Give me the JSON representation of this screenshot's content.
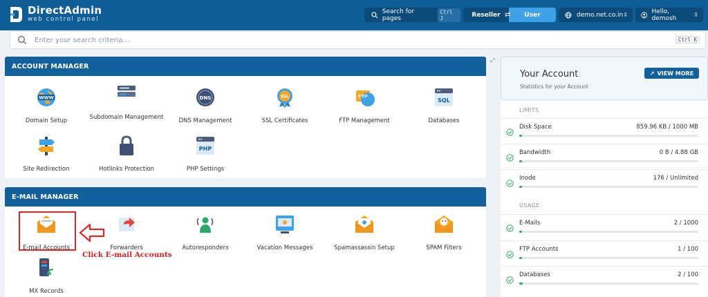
{
  "header": {
    "brand": "DirectAdmin",
    "brand_sub": "web control panel",
    "search_pages_label": "Search for pages",
    "search_pages_shortcut": "Ctrl J",
    "role_reseller": "Reseller",
    "role_user": "User",
    "domain": "demo.net.co.in",
    "greeting": "Hello, demosh"
  },
  "search": {
    "placeholder": "Enter your search criteria...",
    "shortcut": "Ctrl K"
  },
  "account_manager": {
    "title": "ACCOUNT MANAGER",
    "items": [
      {
        "label": "Domain Setup",
        "icon": "globe-www-icon"
      },
      {
        "label": "Subdomain Management",
        "icon": "subdomain-icon"
      },
      {
        "label": "DNS Management",
        "icon": "dns-icon"
      },
      {
        "label": "SSL Certificates",
        "icon": "ssl-badge-icon"
      },
      {
        "label": "FTP Management",
        "icon": "ftp-icon"
      },
      {
        "label": "Databases",
        "icon": "sql-database-icon"
      },
      {
        "label": "Site Redirection",
        "icon": "signpost-icon"
      },
      {
        "label": "Hotlinks Protection",
        "icon": "padlock-icon"
      },
      {
        "label": "PHP Settings",
        "icon": "php-icon"
      }
    ]
  },
  "email_manager": {
    "title": "E-MAIL MANAGER",
    "items": [
      {
        "label": "E-mail Accounts",
        "icon": "envelope-icon"
      },
      {
        "label": "Forwarders",
        "icon": "forward-mail-icon"
      },
      {
        "label": "Autoresponders",
        "icon": "autoresponder-icon"
      },
      {
        "label": "Vacation Messages",
        "icon": "vacation-message-icon"
      },
      {
        "label": "Spamassassin Setup",
        "icon": "spam-envelope-icon"
      },
      {
        "label": "SPAM Filters",
        "icon": "spam-filter-icon"
      },
      {
        "label": "MX Records",
        "icon": "mx-records-icon"
      }
    ]
  },
  "your_account": {
    "title": "Your Account",
    "subtitle": "Statistics for your Account",
    "view_more": "VIEW MORE",
    "limits_label": "LIMITS",
    "usage_label": "USAGE",
    "limits": [
      {
        "name": "Disk Space",
        "value": "859.96 KB / 1000 MB",
        "fraction": 0.001
      },
      {
        "name": "Bandwidth",
        "value": "0 B / 4.88 GB",
        "fraction": 0
      },
      {
        "name": "Inode",
        "value": "176 / Unlimited",
        "fraction": 0
      }
    ],
    "usage": [
      {
        "name": "E-Mails",
        "value": "2 / 1000",
        "fraction": 0.002
      },
      {
        "name": "FTP Accounts",
        "value": "1 / 100",
        "fraction": 0.01
      },
      {
        "name": "Databases",
        "value": "2 / 100",
        "fraction": 0.02
      }
    ]
  },
  "annotation": {
    "callout": "Click E-mail Accounts"
  },
  "colors": {
    "header": "#0f5d97",
    "panel_head": "#12609c",
    "accent": "#3fa2e6",
    "highlight": "#e02525",
    "progress": "#2aa86a"
  }
}
